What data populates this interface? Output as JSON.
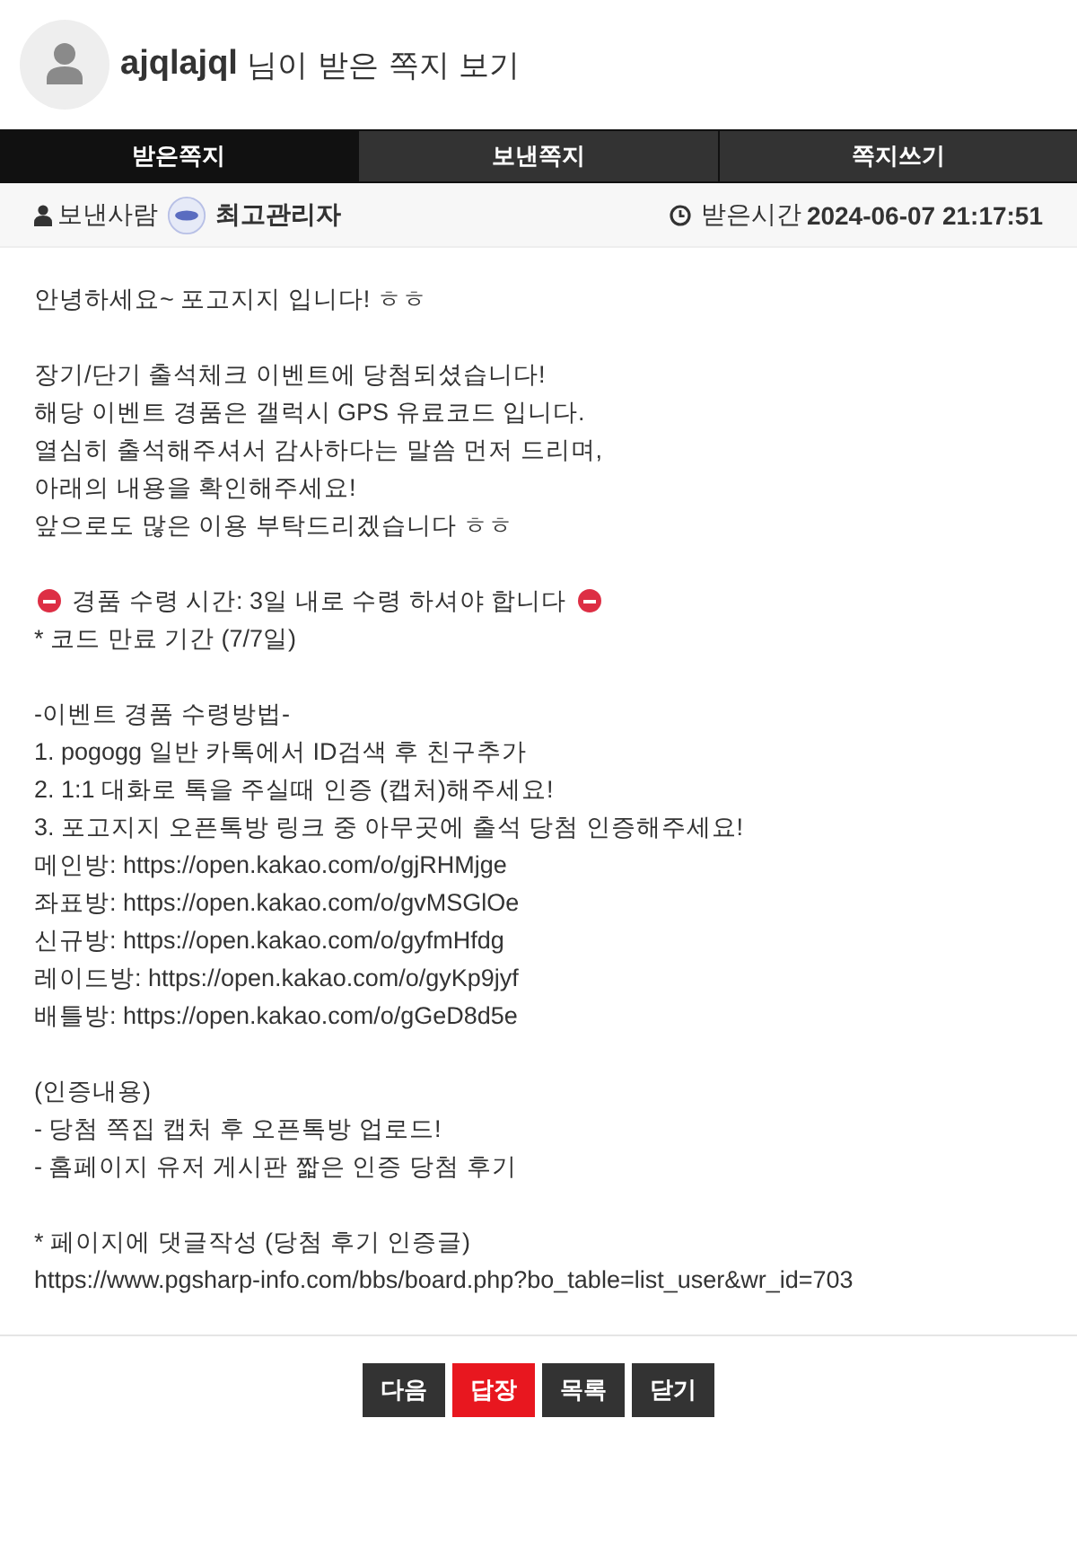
{
  "header": {
    "username": "ajqlajql",
    "title": "님이 받은 쪽지 보기"
  },
  "tabs": [
    {
      "label": "받은쪽지",
      "selected": true
    },
    {
      "label": "보낸쪽지",
      "selected": false
    },
    {
      "label": "쪽지쓰기",
      "selected": false
    }
  ],
  "meta": {
    "sender_label": "보낸사람",
    "sender": "최고관리자",
    "time_label": "받은시간",
    "time": "2024-06-07 21:17:51"
  },
  "body": [
    {
      "lines": [
        {
          "kind": "plain",
          "text": "안녕하세요~ 포고지지 입니다! ㅎㅎ"
        }
      ]
    },
    {
      "lines": [
        {
          "kind": "plain",
          "text": "장기/단기 출석체크 이벤트에 당첨되셨습니다!"
        },
        {
          "kind": "plain",
          "text": "해당 이벤트 경품은 갤럭시 GPS 유료코드 입니다."
        },
        {
          "kind": "plain",
          "text": "열심히 출석해주셔서 감사하다는 말씀 먼저 드리며,"
        },
        {
          "kind": "plain",
          "text": "아래의 내용을 확인해주세요!"
        },
        {
          "kind": "plain",
          "text": "앞으로도 많은 이용 부탁드리겠습니다 ㅎㅎ"
        }
      ]
    },
    {
      "lines": [
        {
          "kind": "warning",
          "text": "경품 수령 시간: 3일 내로 수령 하셔야 합니다"
        },
        {
          "kind": "plain",
          "text": "* 코드 만료 기간 (7/7일)"
        }
      ]
    },
    {
      "lines": [
        {
          "kind": "plain",
          "text": "-이벤트 경품 수령방법-"
        },
        {
          "kind": "plain",
          "text": "1. pogogg 일반 카톡에서 ID검색 후 친구추가"
        },
        {
          "kind": "plain",
          "text": "2. 1:1 대화로 톡을 주실때 인증 (캡처)해주세요!"
        },
        {
          "kind": "plain",
          "text": "3. 포고지지 오픈톡방 링크 중 아무곳에 출석 당첨 인증해주세요!"
        },
        {
          "kind": "plain",
          "text": "메인방: https://open.kakao.com/o/gjRHMjge"
        },
        {
          "kind": "plain",
          "text": "좌표방: https://open.kakao.com/o/gvMSGlOe"
        },
        {
          "kind": "plain",
          "text": "신규방: https://open.kakao.com/o/gyfmHfdg"
        },
        {
          "kind": "plain",
          "text": "레이드방: https://open.kakao.com/o/gyKp9jyf"
        },
        {
          "kind": "plain",
          "text": "배틀방: https://open.kakao.com/o/gGeD8d5e"
        }
      ]
    },
    {
      "lines": [
        {
          "kind": "plain",
          "text": "(인증내용)"
        },
        {
          "kind": "plain",
          "text": "- 당첨 쪽집 캡처 후 오픈톡방 업로드!"
        },
        {
          "kind": "plain",
          "text": "- 홈페이지 유저 게시판 짧은 인증 당첨 후기"
        }
      ]
    },
    {
      "lines": [
        {
          "kind": "plain",
          "text": "* 페이지에 댓글작성 (당첨 후기 인증글)"
        },
        {
          "kind": "plain",
          "text": "https://www.pgsharp-info.com/bbs/board.php?bo_table=list_user&wr_id=703"
        }
      ]
    }
  ],
  "buttons": [
    {
      "label": "다음",
      "kind": "default"
    },
    {
      "label": "답장",
      "kind": "primary"
    },
    {
      "label": "목록",
      "kind": "default"
    },
    {
      "label": "닫기",
      "kind": "default"
    }
  ]
}
